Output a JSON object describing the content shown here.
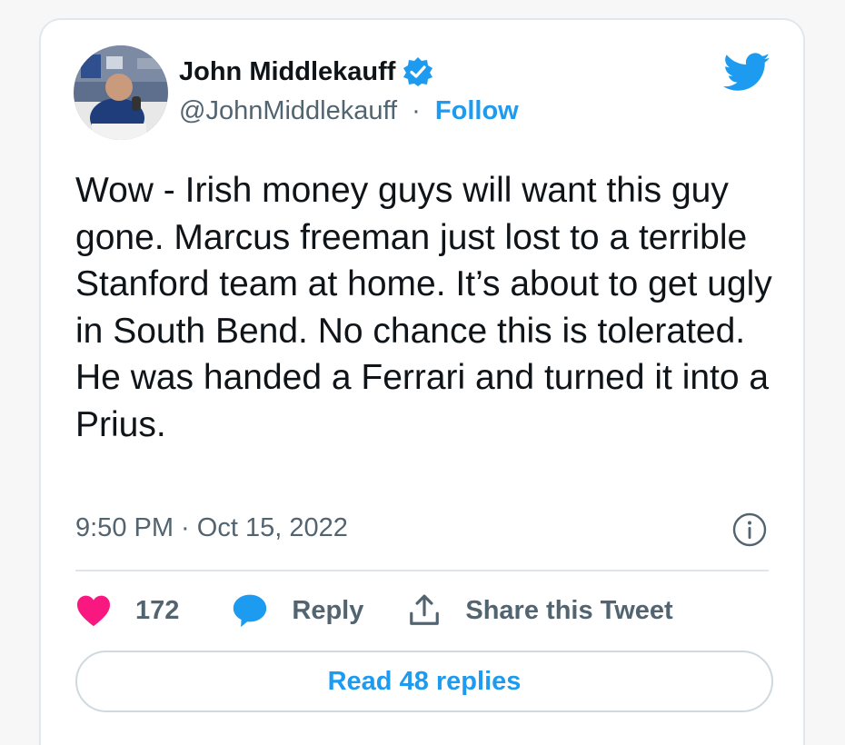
{
  "author": {
    "display_name": "John Middlekauff",
    "handle": "@JohnMiddlekauff",
    "separator": "·",
    "follow_label": "Follow",
    "verified": true
  },
  "tweet": {
    "text": "Wow - Irish money guys will want this guy gone. Marcus freeman just lost to a terrible Stanford team at home. It’s about to get ugly in South Bend. No chance this is tolerated. He was handed a Ferrari and turned it into a Prius.",
    "timestamp": "9:50 PM · Oct 15, 2022"
  },
  "actions": {
    "like_count": "172",
    "reply_label": "Reply",
    "share_label": "Share this Tweet"
  },
  "footer": {
    "read_replies_label": "Read 48 replies"
  },
  "icons": {
    "brand": "twitter-bird-icon",
    "verified": "verified-badge-icon",
    "info": "info-icon",
    "like": "heart-icon",
    "reply": "speech-bubble-icon",
    "share": "share-upload-icon"
  },
  "colors": {
    "accent": "#1d9bf0",
    "like": "#f91880",
    "text": "#0f1419",
    "secondary": "#536471"
  }
}
